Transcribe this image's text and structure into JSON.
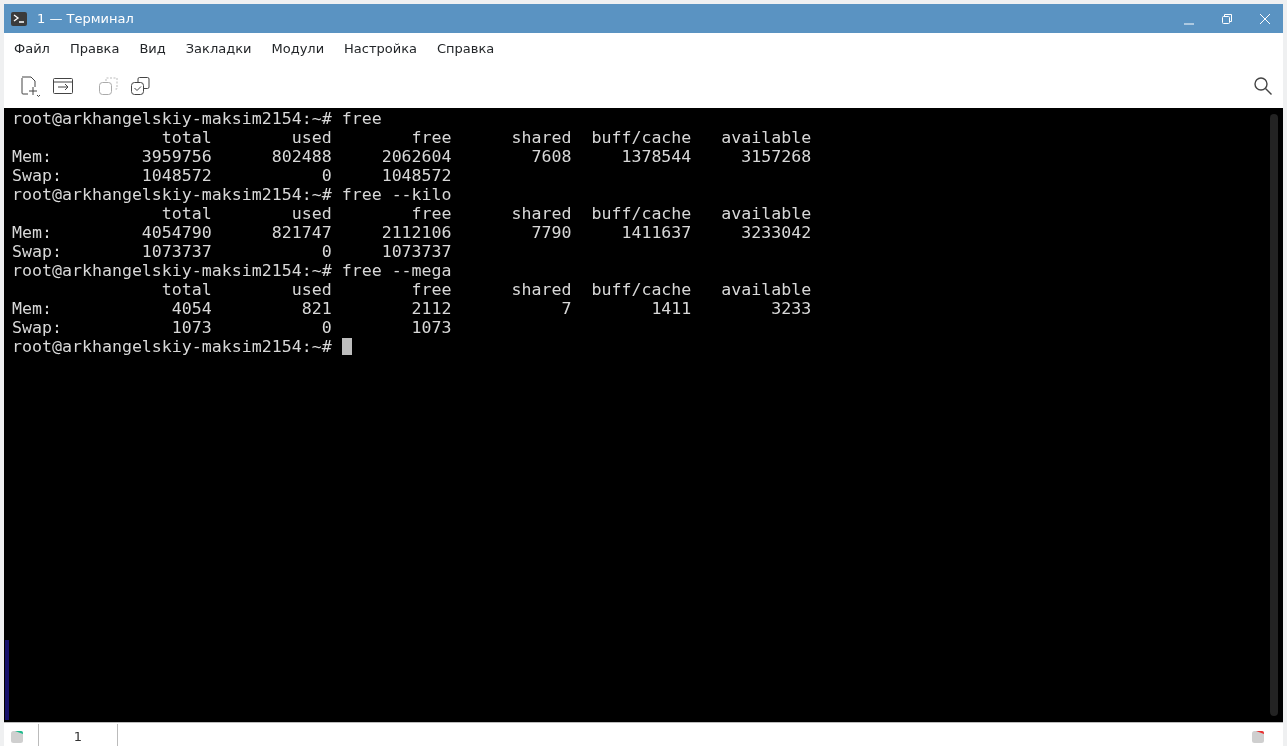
{
  "window": {
    "title": "1 — Терминал"
  },
  "menu": [
    "Файл",
    "Правка",
    "Вид",
    "Закладки",
    "Модули",
    "Настройка",
    "Справка"
  ],
  "terminal": {
    "lines": [
      "root@arkhangelskiy-maksim2154:~# free",
      "               total        used        free      shared  buff/cache   available",
      "Mem:         3959756      802488     2062604        7608     1378544     3157268",
      "Swap:        1048572           0     1048572",
      "root@arkhangelskiy-maksim2154:~# free --kilo",
      "               total        used        free      shared  buff/cache   available",
      "Mem:         4054790      821747     2112106        7790     1411637     3233042",
      "Swap:        1073737           0     1073737",
      "root@arkhangelskiy-maksim2154:~# free --mega",
      "               total        used        free      shared  buff/cache   available",
      "Mem:            4054         821        2112           7        1411        3233",
      "Swap:           1073           0        1073",
      "root@arkhangelskiy-maksim2154:~# "
    ]
  },
  "tabs": [
    {
      "label": "1",
      "selected": true
    }
  ]
}
